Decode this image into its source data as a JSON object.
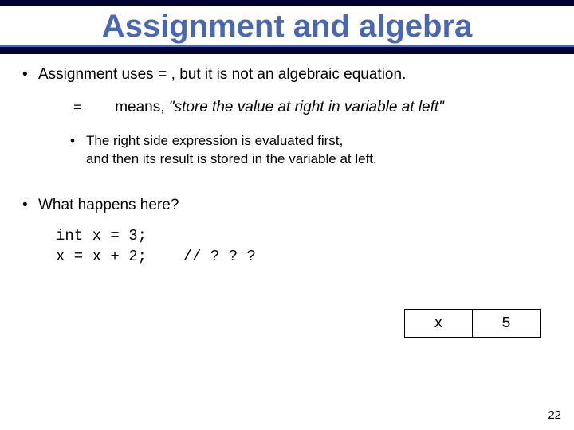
{
  "title": "Assignment and algebra",
  "bullets": {
    "b1_prefix": "Assignment uses ",
    "b1_eq": "=",
    "b1_suffix": " , but it is not an algebraic equation.",
    "means_eq": "=",
    "means_word": "means,",
    "means_quote": " \"store the value at right in variable at left\"",
    "sub1_line1": "The right side expression is evaluated first,",
    "sub1_line2": "and then its result is stored in the variable at left.",
    "b2": "What happens here?"
  },
  "code": {
    "line1": "int x = 3;",
    "line2": "x = x + 2;    // ? ? ?"
  },
  "var_table": {
    "name": "x",
    "value": "5"
  },
  "page_number": "22"
}
